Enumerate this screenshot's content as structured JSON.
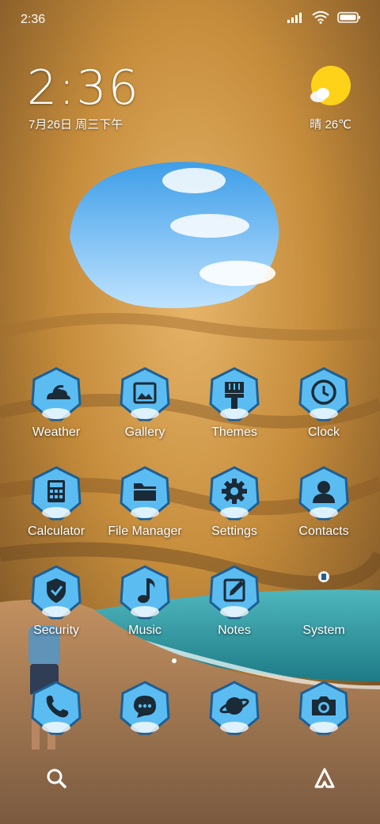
{
  "status_bar": {
    "time": "2:36",
    "icons": [
      "signal-icon",
      "wifi-icon",
      "battery-icon"
    ]
  },
  "lockclock": {
    "time": "2:36",
    "date": "7月26日 周三下午"
  },
  "weather": {
    "icon": "partly-sunny-icon",
    "text": "晴 26℃"
  },
  "apps": [
    {
      "label": "Weather",
      "icon": "weather-icon"
    },
    {
      "label": "Gallery",
      "icon": "gallery-icon"
    },
    {
      "label": "Themes",
      "icon": "brush-icon"
    },
    {
      "label": "Clock",
      "icon": "clock-icon"
    },
    {
      "label": "Calculator",
      "icon": "calculator-icon"
    },
    {
      "label": "File Manager",
      "icon": "folder-icon"
    },
    {
      "label": "Settings",
      "icon": "gear-icon"
    },
    {
      "label": "Contacts",
      "icon": "person-icon"
    },
    {
      "label": "Security",
      "icon": "shield-icon"
    },
    {
      "label": "Music",
      "icon": "music-note-icon"
    },
    {
      "label": "Notes",
      "icon": "notes-icon"
    },
    {
      "label": "System",
      "icon": "folder-system-icon"
    }
  ],
  "dock": [
    {
      "icon": "phone-icon"
    },
    {
      "icon": "message-icon"
    },
    {
      "icon": "browser-planet-icon"
    },
    {
      "icon": "camera-icon"
    }
  ],
  "colors": {
    "badge_fill": "#5bbcf2",
    "badge_stroke": "#1d5f93",
    "glyph": "#1a2a36",
    "sun": "#ffd21a"
  }
}
